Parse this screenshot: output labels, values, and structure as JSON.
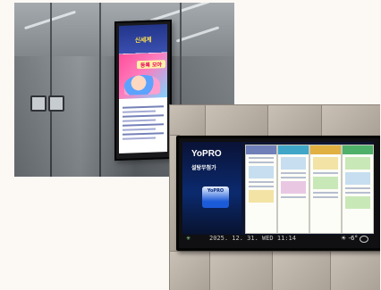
{
  "elevator_photo": {
    "display": {
      "ad_title": "신세계",
      "ad_banner_text": "등록 모아"
    }
  },
  "wall_photo": {
    "display": {
      "brand": "YoPRO",
      "tagline": "설탕무첨가",
      "pack_label": "YoPRO",
      "status_date": "2025. 12. 31. WED",
      "status_time": "11:14",
      "weather": "-6°"
    }
  }
}
